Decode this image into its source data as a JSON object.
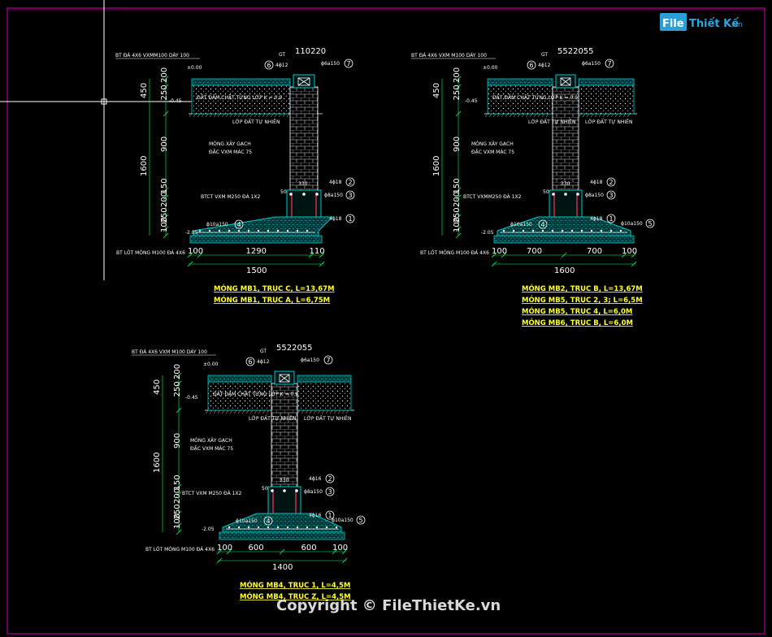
{
  "watermark": {
    "logo_left": "File",
    "logo_right": "Thiết Kế",
    "logo_suffix": ".vn",
    "copyright": "Copyright © FileThietKe.vn"
  },
  "colors": {
    "background": "#000000",
    "frame": "#b0009a",
    "concrete": "#00c8c8",
    "dim": "#00ff66",
    "title": "#ffff33",
    "rebar": "#ff3355",
    "text": "#ffffff"
  },
  "details": [
    {
      "top_note": "BT ĐÁ 4X6 VXMM100 DÀY 100",
      "level_top": "±0.00",
      "level_ground": "-0.45",
      "level_bottom": "-2.05",
      "fill_label": "ĐẤT ĐẦM CHẶT TỪNG LỚP K = 0.9",
      "soil_label": "LỚP ĐẤT TỰ NHIÊN",
      "masonry_label": [
        "MÓNG XÂY GẠCH",
        "ĐẶC VXM MÁC 75"
      ],
      "concrete_label": "BTCT VXM M250 ĐÁ 1X2",
      "lean_label": "BT LÓT MÓNG M100 ĐÁ 4X6",
      "tie_label": "GT",
      "dim_top": [
        "110",
        "220"
      ],
      "bar_6": "4ϕ12",
      "bar_7": "ϕ6a150",
      "bar_2": "4ϕ18",
      "bar_3": "ϕ8a150",
      "bar_4": "ϕ10a150",
      "bar_1": "4ϕ18",
      "ped_w": "330",
      "ped_base": "50",
      "vdims_outer": [
        "450",
        "1600"
      ],
      "vdims_inner": [
        "200",
        "250",
        "900",
        "150",
        "200",
        "250",
        "100"
      ],
      "bottom_dims": [
        "100",
        "1290",
        "110"
      ],
      "bottom_total": "1500",
      "titles": [
        "MÓNG MB1, TRỤC C, L=13,67M",
        "MÓNG MB1, TRỤC A, L=6,75M"
      ]
    },
    {
      "top_note": "BT ĐÁ 4X6 VXM M100 DÀY 100",
      "level_top": "±0.00",
      "level_ground": "-0.45",
      "level_bottom": "-2.05",
      "fill_label": "ĐẤT ĐẦM CHẶT TỪNG LỚP K = 0.9",
      "soil_label": "LỚP ĐẤT TỰ NHIÊN",
      "masonry_label": [
        "MÓNG XÂY GẠCH",
        "ĐẶC VXM MÁC 75"
      ],
      "concrete_label": "BTCT VXMM250 ĐÁ 1X2",
      "lean_label": "BT LÓT MÓNG M100 ĐÁ 4X6",
      "tie_label": "GT",
      "dim_top": [
        "55",
        "220",
        "55"
      ],
      "bar_6": "4ϕ12",
      "bar_7": "ϕ6a150",
      "bar_2": "4ϕ18",
      "bar_3": "ϕ8a150",
      "bar_4": "ϕ10a150",
      "bar_1": "4ϕ18",
      "ped_w": "330",
      "ped_base": "50",
      "vdims_outer": [
        "450",
        "1600"
      ],
      "vdims_inner": [
        "200",
        "250",
        "900",
        "150",
        "200",
        "250",
        "100"
      ],
      "bottom_dims": [
        "100",
        "700",
        "700",
        "100"
      ],
      "bottom_total": "1600",
      "titles": [
        "MÓNG MB2, TRỤC B, L=13,67M",
        "MÓNG MB5, TRỤC 2, 3; L=6,5M",
        "MÓNG MB5, TRỤC 4, L=6,0M",
        "MÓNG MB6, TRỤC B, L=6,0M"
      ]
    },
    {
      "top_note": "BT ĐÁ 4X6 VXM M100 DÀY 100",
      "level_top": "±0.00",
      "level_ground": "-0.45",
      "level_bottom": "-2.05",
      "fill_label": "ĐẤT ĐẦM CHẶT TỪNG LỚP K = 0.9",
      "soil_label": "LỚP ĐẤT TỰ NHIÊN",
      "masonry_label": [
        "MÓNG XÂY GẠCH",
        "ĐẶC VXM MÁC 75"
      ],
      "concrete_label": "BTCT VXM M250 ĐÁ 1X2",
      "lean_label": "BT LÓT MÓNG M100 ĐÁ 4X6",
      "tie_label": "GT",
      "dim_top": [
        "55",
        "220",
        "55"
      ],
      "bar_6": "4ϕ12",
      "bar_7": "ϕ6a150",
      "bar_2": "4ϕ16",
      "bar_3": "ϕ8a150",
      "bar_4": "ϕ10a150",
      "bar_1": "4ϕ16",
      "ped_w": "330",
      "ped_base": "50",
      "vdims_outer": [
        "450",
        "1600"
      ],
      "vdims_inner": [
        "200",
        "250",
        "900",
        "150",
        "200",
        "250",
        "100"
      ],
      "bottom_dims": [
        "100",
        "600",
        "600",
        "100"
      ],
      "bottom_total": "1400",
      "titles": [
        "MÓNG MB4, TRỤC 1, L=4,5M",
        "MÓNG MB4, TRỤC Z, L=4,5M"
      ]
    }
  ]
}
